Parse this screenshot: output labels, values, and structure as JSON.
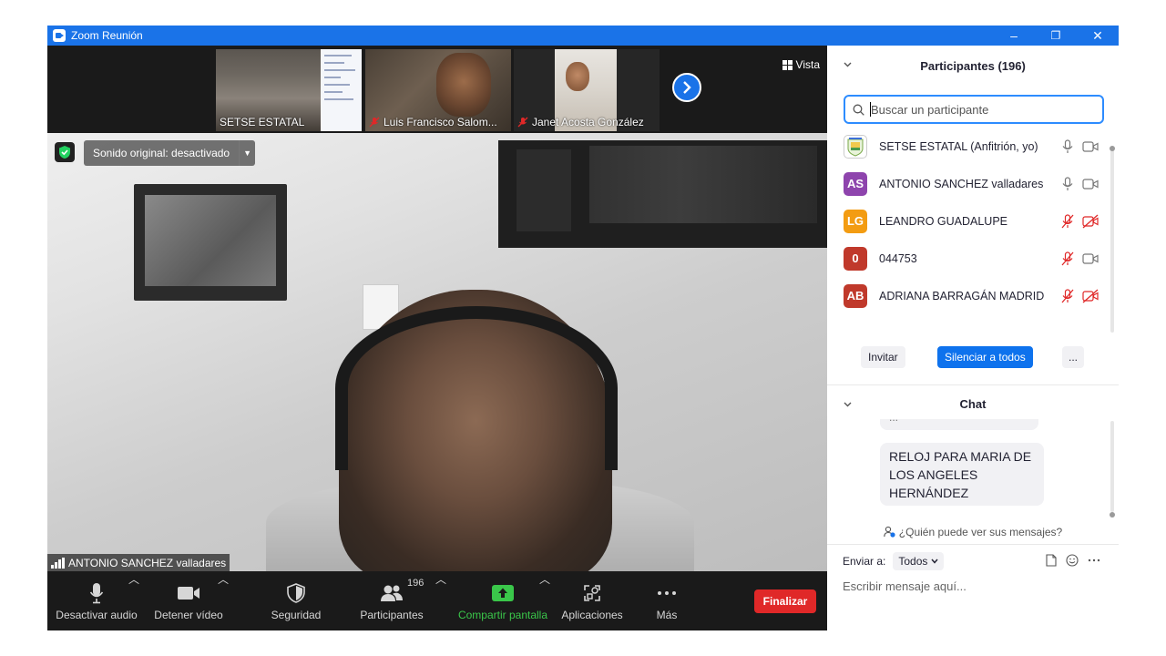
{
  "window": {
    "title": "Zoom Reunión",
    "controls": {
      "minimize": "–",
      "restore": "❐",
      "close": "✕"
    }
  },
  "strip": {
    "thumbnails": [
      {
        "name": "SETSE ESTATAL",
        "muted": false
      },
      {
        "name": "Luis Francisco Salom...",
        "muted": true
      },
      {
        "name": "Janet Acosta González",
        "muted": true
      }
    ],
    "view_label": "Vista"
  },
  "main_video": {
    "original_sound": "Sonido original: desactivado",
    "speaker": "ANTONIO SANCHEZ valladares"
  },
  "toolbar": {
    "audio": "Desactivar audio",
    "video": "Detener vídeo",
    "security": "Seguridad",
    "participants": "Participantes",
    "participants_count": "196",
    "share": "Compartir pantalla",
    "apps": "Aplicaciones",
    "more": "Más",
    "end": "Finalizar"
  },
  "participants_panel": {
    "title": "Participantes (196)",
    "search_placeholder": "Buscar un participante",
    "list": [
      {
        "initials": "",
        "name": "SETSE ESTATAL (Anfitrión, yo)",
        "color": "#ffffff",
        "mic_muted": false,
        "video_off": false
      },
      {
        "initials": "AS",
        "name": "ANTONIO SANCHEZ valladares",
        "color": "#8e44ad",
        "mic_muted": false,
        "video_off": false
      },
      {
        "initials": "LG",
        "name": " LEANDRO GUADALUPE",
        "color": "#f39c12",
        "mic_muted": true,
        "video_off": true
      },
      {
        "initials": "0",
        "name": "044753",
        "color": "#c0392b",
        "mic_muted": true,
        "video_off": false
      },
      {
        "initials": "AB",
        "name": "ADRIANA BARRAGÁN MADRID",
        "color": "#c0392b",
        "mic_muted": true,
        "video_off": true
      }
    ],
    "invite": "Invitar",
    "mute_all": "Silenciar a todos",
    "more": "..."
  },
  "chat": {
    "title": "Chat",
    "prev_message_fragment": "...",
    "message": "RELOJ PARA  MARIA DE LOS ANGELES HERNÁNDEZ",
    "who_can_see": "¿Quién puede ver sus mensajes?",
    "send_to_label": "Enviar a:",
    "send_to_value": "Todos",
    "input_placeholder": "Escribir mensaje aquí..."
  }
}
